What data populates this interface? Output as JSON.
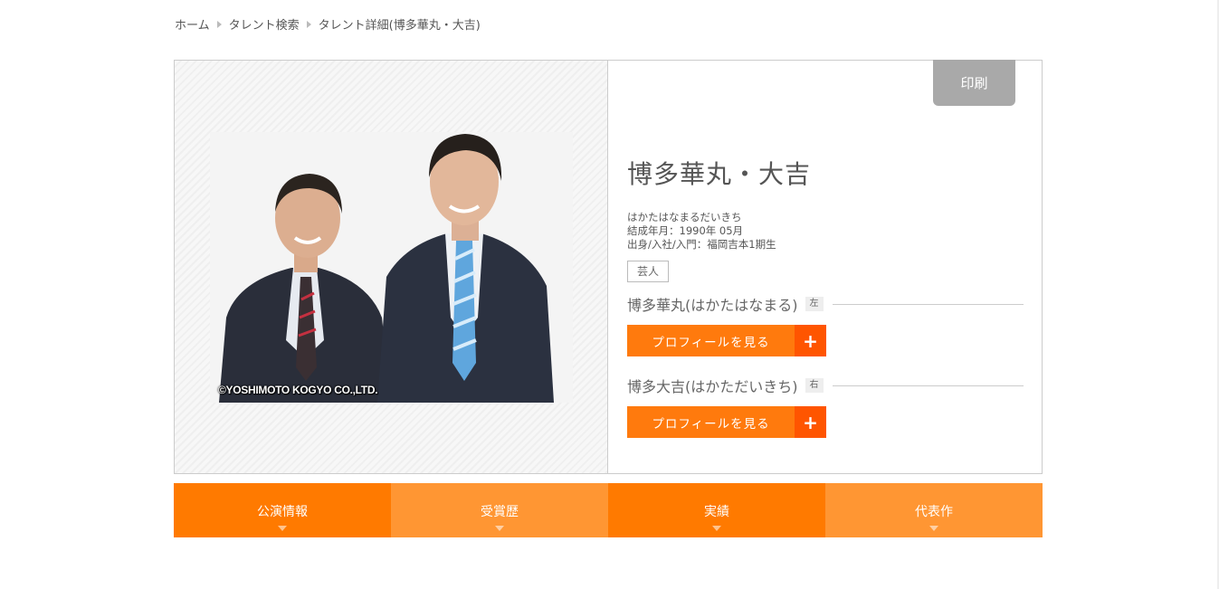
{
  "breadcrumb": {
    "home": "ホーム",
    "search": "タレント検索",
    "current": "タレント詳細(博多華丸・大吉)"
  },
  "print_label": "印刷",
  "photo": {
    "copyright": "©YOSHIMOTO KOGYO CO.,LTD."
  },
  "talent": {
    "name": "博多華丸・大吉",
    "reading": "はかたはなまるだいきち",
    "formed": "結成年月：1990年 05月",
    "origin": "出身/入社/入門：福岡吉本1期生",
    "category": "芸人"
  },
  "members": [
    {
      "name": "博多華丸(はかたはなまる)",
      "position": "左",
      "button_label": "プロフィールを見る",
      "plus": "+"
    },
    {
      "name": "博多大吉(はかただいきち)",
      "position": "右",
      "button_label": "プロフィールを見る",
      "plus": "+"
    }
  ],
  "tabs": [
    {
      "label": "公演情報"
    },
    {
      "label": "受賞歴"
    },
    {
      "label": "実績"
    },
    {
      "label": "代表作"
    }
  ],
  "colors": {
    "accent": "#ff7a0d",
    "accent_dark": "#ff5500",
    "tab_dark": "#ff7a00",
    "tab_light": "#ff9633",
    "print_button": "#a9a9a9"
  }
}
